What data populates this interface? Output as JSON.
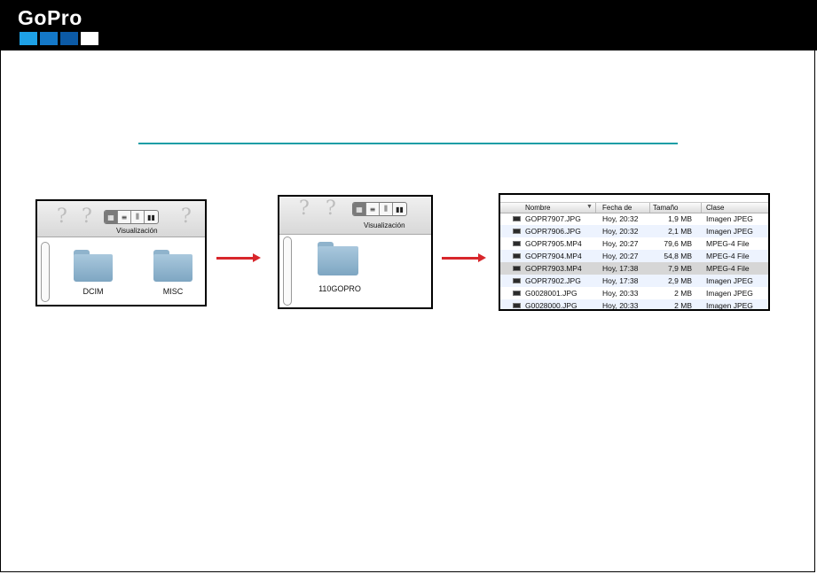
{
  "brand": {
    "name": "GoPro",
    "colors": {
      "header": "#000000",
      "sq1": "#1ea1e6",
      "sq2": "#1478c8",
      "sq3": "#0c5aa6",
      "sq4": "#ffffff",
      "rule": "#1a9ea6",
      "arrow": "#d8262b"
    }
  },
  "window1": {
    "toolbar_label": "Visualización",
    "help_glyph": "?",
    "view_glyphs": [
      "▦",
      "≡",
      "⫼",
      "▮▮"
    ],
    "folders": [
      "DCIM",
      "MISC"
    ]
  },
  "window2": {
    "toolbar_label": "Visualización",
    "help_glyph": "?",
    "view_glyphs": [
      "▦",
      "≡",
      "⫼",
      "▮▮"
    ],
    "folders": [
      "110GOPRO"
    ]
  },
  "window3": {
    "columns": {
      "name": "Nombre",
      "date": "Fecha de",
      "size": "Tamaño",
      "kind": "Clase"
    },
    "sort_glyph": "▼",
    "files": [
      {
        "name": "GOPR7907.JPG",
        "date": "Hoy, 20:32",
        "size": "1,9 MB",
        "kind": "Imagen JPEG"
      },
      {
        "name": "GOPR7906.JPG",
        "date": "Hoy, 20:32",
        "size": "2,1 MB",
        "kind": "Imagen JPEG"
      },
      {
        "name": "GOPR7905.MP4",
        "date": "Hoy, 20:27",
        "size": "79,6 MB",
        "kind": "MPEG-4 File"
      },
      {
        "name": "GOPR7904.MP4",
        "date": "Hoy, 20:27",
        "size": "54,8 MB",
        "kind": "MPEG-4 File"
      },
      {
        "name": "GOPR7903.MP4",
        "date": "Hoy, 17:38",
        "size": "7,9 MB",
        "kind": "MPEG-4 File"
      },
      {
        "name": "GOPR7902.JPG",
        "date": "Hoy, 17:38",
        "size": "2,9 MB",
        "kind": "Imagen JPEG"
      },
      {
        "name": "G0028001.JPG",
        "date": "Hoy, 20:33",
        "size": "2 MB",
        "kind": "Imagen JPEG"
      },
      {
        "name": "G0028000.JPG",
        "date": "Hoy, 20:33",
        "size": "2 MB",
        "kind": "Imagen JPEG"
      }
    ],
    "selected_index": 4
  }
}
